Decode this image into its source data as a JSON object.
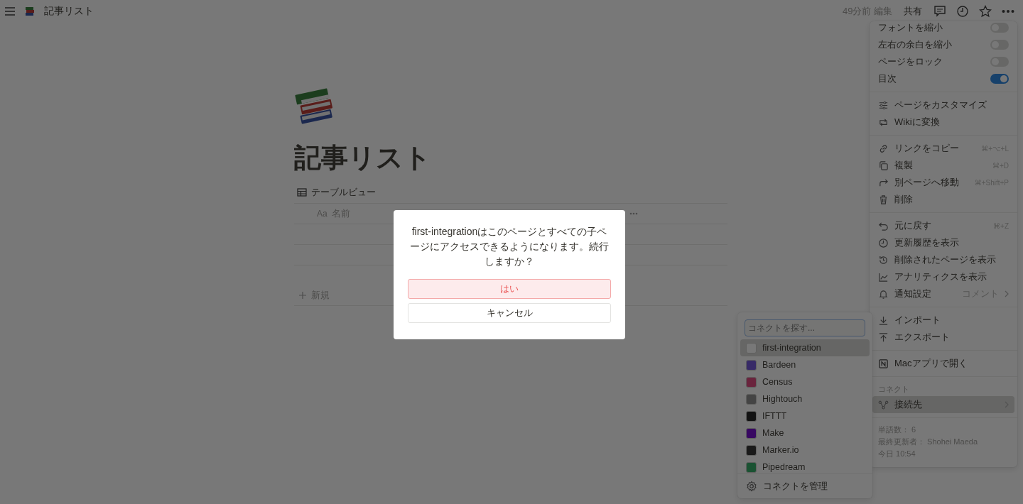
{
  "topbar": {
    "title": "記事リスト",
    "edited": "49分前 編集",
    "share": "共有"
  },
  "page": {
    "title": "記事リスト",
    "view_tab": "テーブルビュー",
    "table": {
      "columns": [
        {
          "type_icon": "Aa",
          "label": "名前"
        }
      ],
      "new_row": "新規"
    }
  },
  "menu": {
    "groups": [
      {
        "items": [
          {
            "kind": "toggle",
            "label": "フォントを縮小",
            "on": false
          },
          {
            "kind": "toggle",
            "label": "左右の余白を縮小",
            "on": false
          },
          {
            "kind": "toggle",
            "label": "ページをロック",
            "on": false
          },
          {
            "kind": "toggle",
            "label": "目次",
            "on": true
          }
        ]
      },
      {
        "items": [
          {
            "kind": "action",
            "label": "ページをカスタマイズ"
          },
          {
            "kind": "action",
            "label": "Wikiに変換"
          }
        ]
      },
      {
        "items": [
          {
            "kind": "action",
            "label": "リンクをコピー",
            "shortcut": "⌘+⌥+L"
          },
          {
            "kind": "action",
            "label": "複製",
            "shortcut": "⌘+D"
          },
          {
            "kind": "action",
            "label": "別ページへ移動",
            "shortcut": "⌘+Shift+P"
          },
          {
            "kind": "action",
            "label": "削除"
          }
        ]
      },
      {
        "items": [
          {
            "kind": "action",
            "label": "元に戻す",
            "shortcut": "⌘+Z"
          },
          {
            "kind": "action",
            "label": "更新履歴を表示"
          },
          {
            "kind": "action",
            "label": "削除されたページを表示"
          },
          {
            "kind": "action",
            "label": "アナリティクスを表示"
          },
          {
            "kind": "submenu",
            "label": "通知設定",
            "value": "コメント",
            "expanded": false
          }
        ]
      },
      {
        "items": [
          {
            "kind": "action",
            "label": "インポート"
          },
          {
            "kind": "action",
            "label": "エクスポート"
          }
        ]
      },
      {
        "items": [
          {
            "kind": "action",
            "label": "Macアプリで開く"
          }
        ]
      },
      {
        "label": "コネクト",
        "items": [
          {
            "kind": "submenu",
            "label": "接続先",
            "expanded": true
          }
        ]
      }
    ],
    "footer": [
      "単語数： 6",
      "最終更新者： Shohei Maeda",
      "今日 10:54"
    ]
  },
  "connect_menu": {
    "search": {
      "placeholder": "コネクトを探す..."
    },
    "items": [
      {
        "name": "first-integration",
        "selected": true
      },
      {
        "name": "Bardeen",
        "selected": false
      },
      {
        "name": "Census",
        "selected": false
      },
      {
        "name": "Hightouch",
        "selected": false
      },
      {
        "name": "IFTTT",
        "selected": false
      },
      {
        "name": "Make",
        "selected": false
      },
      {
        "name": "Marker.io",
        "selected": false
      },
      {
        "name": "Pipedream",
        "selected": false
      }
    ],
    "manage": "コネクトを管理"
  },
  "dialog": {
    "message": "first-integrationはこのページとすべての子ページにアクセスできるようになります。続行しますか？",
    "confirm": "はい",
    "cancel": "キャンセル"
  }
}
